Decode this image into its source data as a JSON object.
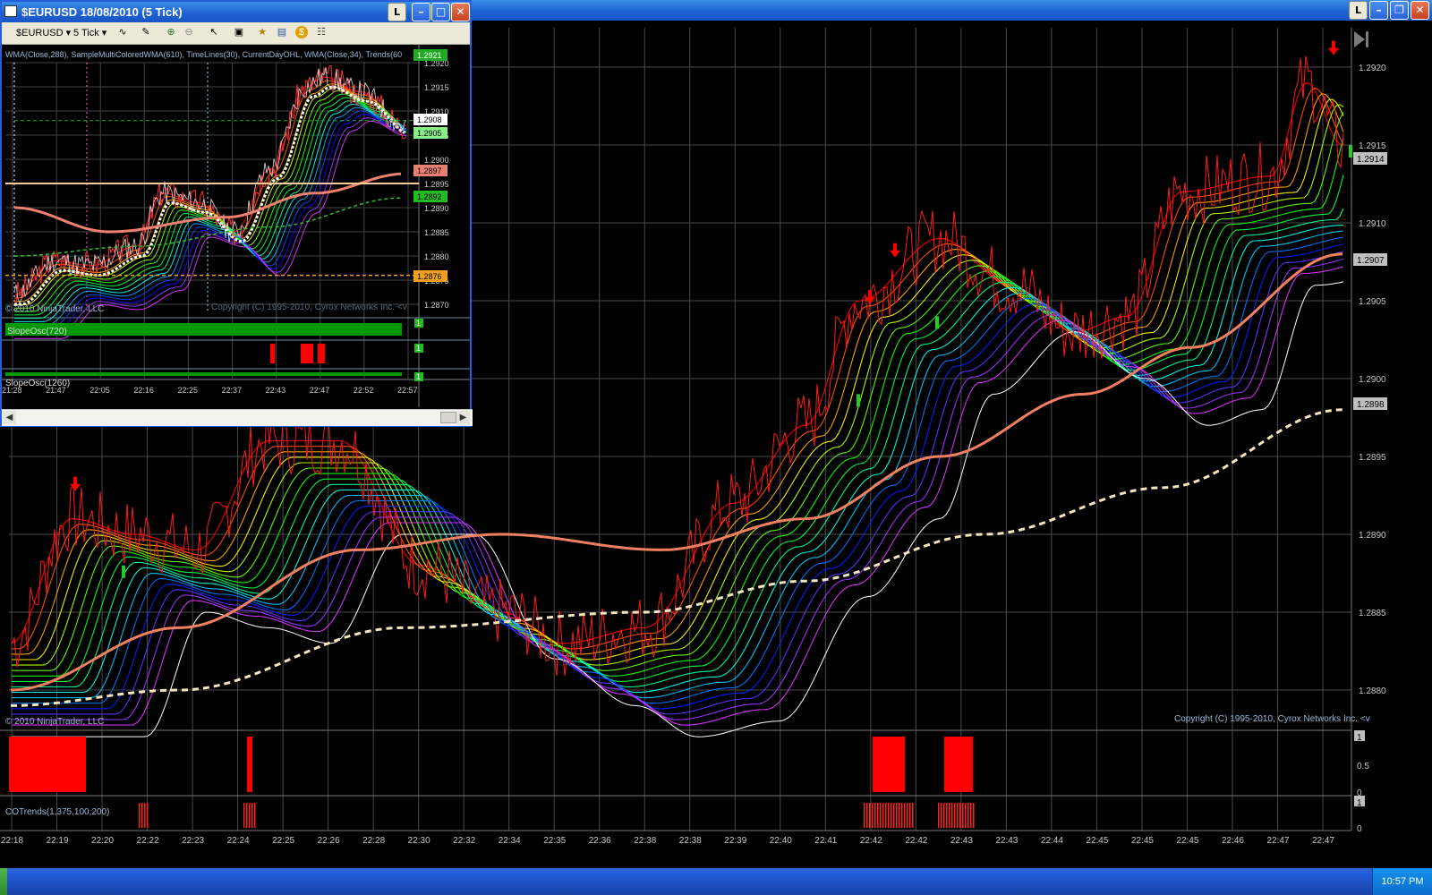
{
  "main_window": {
    "l_button": "L",
    "price_labels": [
      "1.2920",
      "1.2915",
      "1.2910",
      "1.2905",
      "1.2900",
      "1.2895",
      "1.2890",
      "1.2885",
      "1.2880"
    ],
    "price_markers": [
      {
        "value": "1.2914",
        "color": "#bfbfbf",
        "text_color": "#000000"
      },
      {
        "value": "1.2907",
        "color": "#bfbfbf",
        "text_color": "#000000"
      },
      {
        "value": "1.2898",
        "color": "#bfbfbf",
        "text_color": "#000000"
      }
    ],
    "time_labels": [
      "22:18",
      "22:19",
      "22:20",
      "22:22",
      "22:23",
      "22:24",
      "22:25",
      "22:26",
      "22:28",
      "22:30",
      "22:32",
      "22:34",
      "22:35",
      "22:36",
      "22:38",
      "22:38",
      "22:39",
      "22:40",
      "22:41",
      "22:42",
      "22:42",
      "22:43",
      "22:43",
      "22:44",
      "22:45",
      "22:45",
      "22:45",
      "22:46",
      "22:47",
      "22:47"
    ],
    "copyright_left": "© 2010 NinjaTrader, LLC",
    "copyright_right": "Copyright (C) 1995-2010, Cyrox Networks Inc. <v",
    "panel1_labels": [
      "1",
      "0.5",
      "0"
    ],
    "panel2_name": "COTrends(1,375,100,200)",
    "panel2_labels": [
      "1",
      "0"
    ]
  },
  "sub_window": {
    "title": "$EURUSD  18/08/2010 (5 Tick)",
    "l_button": "L",
    "toolbar": {
      "instrument": "$EURUSD",
      "interval": "5 Tick"
    },
    "indicators": "WMA(Close,288), SampleMultiColoredWMA(610), TimeLines(30), CurrentDayOHL, WMA(Close,34), Trends(60",
    "price_labels": [
      "1.2920",
      "1.2915",
      "1.2910",
      "1.2905",
      "1.2900",
      "1.2895",
      "1.2890",
      "1.2885",
      "1.2880",
      "1.2875",
      "1.2870"
    ],
    "price_markers": [
      {
        "value": "1.2921",
        "color": "#22aa22",
        "text_color": "#ffffff"
      },
      {
        "value": "1.2908",
        "color": "#ffffff",
        "text_color": "#000000"
      },
      {
        "value": "1.2905",
        "color": "#88ee88",
        "text_color": "#000000"
      },
      {
        "value": "1.2897",
        "color": "#e88070",
        "text_color": "#000000"
      },
      {
        "value": "1.2892",
        "color": "#22bb22",
        "text_color": "#000000"
      },
      {
        "value": "1.2876",
        "color": "#f0a020",
        "text_color": "#000000"
      }
    ],
    "copyright_left": "© 2010 NinjaTrader, LLC",
    "copyright_right": "Copyright (C) 1995-2010, Cyrox Networks Inc. <v",
    "panel1_name": "SlopeOsc(720)",
    "panel2_name": "SlopeOsc(1260)",
    "panel_label": "1",
    "time_labels": [
      "21:28",
      "21:47",
      "22:05",
      "22:16",
      "22:25",
      "22:37",
      "22:43",
      "22:47",
      "22:52",
      "22:57"
    ]
  },
  "taskbar": {
    "clock": "10:57 PM"
  },
  "colors": {
    "titlebar": "#245edb",
    "grid": "#555555",
    "wma_orange": "#f08060",
    "wma_dashed": "#f5e6c0",
    "signal_red": "#ff0000",
    "signal_green": "#22cc22"
  }
}
